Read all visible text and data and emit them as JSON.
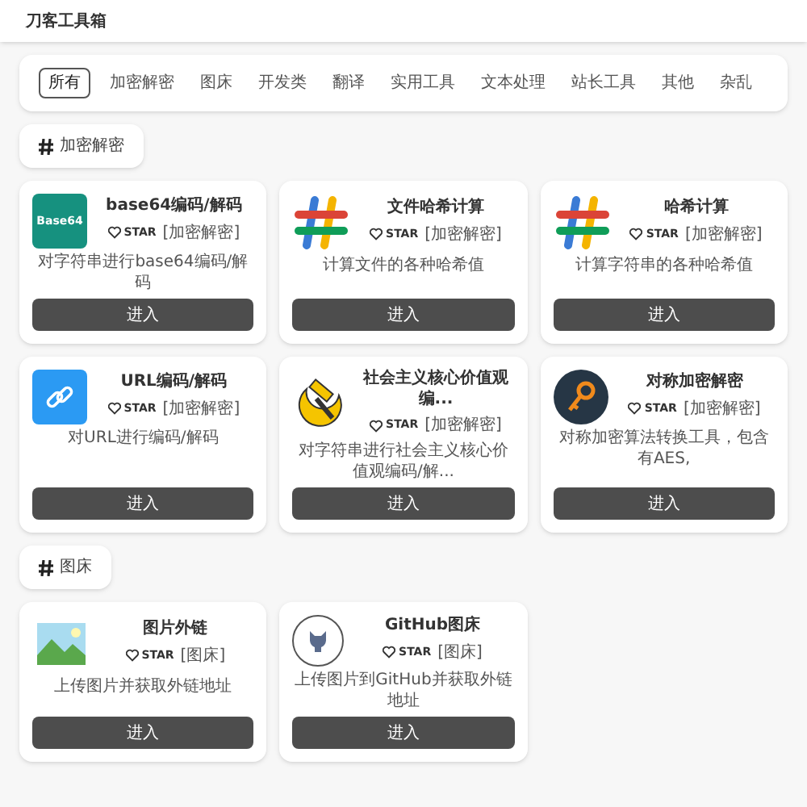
{
  "app_title": "刀客工具箱",
  "filters": [
    {
      "label": "所有",
      "selected": true
    },
    {
      "label": "加密解密",
      "selected": false
    },
    {
      "label": "图床",
      "selected": false
    },
    {
      "label": "开发类",
      "selected": false
    },
    {
      "label": "翻译",
      "selected": false
    },
    {
      "label": "实用工具",
      "selected": false
    },
    {
      "label": "文本处理",
      "selected": false
    },
    {
      "label": "站长工具",
      "selected": false
    },
    {
      "label": "其他",
      "selected": false
    },
    {
      "label": "杂乱",
      "selected": false
    }
  ],
  "sections": [
    {
      "heading": "加密解密",
      "tools": [
        {
          "kind": "base64",
          "logo_text": "Base64",
          "title": "base64编码/解码",
          "star": "STAR",
          "tag": "[加密解密]",
          "description": "对字符串进行base64编码/解码",
          "button": "进入"
        },
        {
          "kind": "hash",
          "title": "文件哈希计算",
          "star": "STAR",
          "tag": "[加密解密]",
          "description": "计算文件的各种哈希值",
          "button": "进入"
        },
        {
          "kind": "hash",
          "title": "哈希计算",
          "star": "STAR",
          "tag": "[加密解密]",
          "description": "计算字符串的各种哈希值",
          "button": "进入"
        },
        {
          "kind": "link",
          "title": "URL编码/解码",
          "star": "STAR",
          "tag": "[加密解密]",
          "description": "对URL进行编码/解码",
          "button": "进入"
        },
        {
          "kind": "emblem",
          "title": "社会主义核心价值观编...",
          "star": "STAR",
          "tag": "[加密解密]",
          "description": "对字符串进行社会主义核心价值观编码/解...",
          "button": "进入"
        },
        {
          "kind": "key",
          "title": "对称加密解密",
          "star": "STAR",
          "tag": "[加密解密]",
          "description": "对称加密算法转换工具，包含有AES,",
          "button": "进入"
        }
      ]
    },
    {
      "heading": "图床",
      "tools": [
        {
          "kind": "image",
          "title": "图片外链",
          "star": "STAR",
          "tag": "[图床]",
          "description": "上传图片并获取外链地址",
          "button": "进入"
        },
        {
          "kind": "cat",
          "title": "GitHub图床",
          "star": "STAR",
          "tag": "[图床]",
          "description": "上传图片到GitHub并获取外链地址",
          "button": "进入"
        }
      ]
    }
  ]
}
